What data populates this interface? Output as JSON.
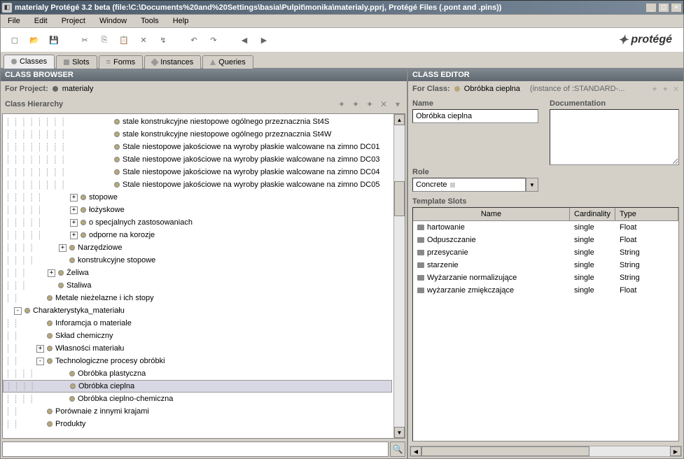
{
  "window": {
    "title": "materialy  Protégé 3.2 beta    (file:\\C:\\Documents%20and%20Settings\\basia\\Pulpit\\monika\\materialy.pprj, Protégé Files (.pont and .pins))"
  },
  "menu": [
    "File",
    "Edit",
    "Project",
    "Window",
    "Tools",
    "Help"
  ],
  "logo_text": "protégé",
  "tabs": [
    {
      "label": "Classes",
      "icon": "circle",
      "active": true
    },
    {
      "label": "Slots",
      "icon": "square",
      "active": false
    },
    {
      "label": "Forms",
      "icon": "lines",
      "active": false
    },
    {
      "label": "Instances",
      "icon": "diamond",
      "active": false
    },
    {
      "label": "Queries",
      "icon": "tri",
      "active": false
    }
  ],
  "browser": {
    "title": "CLASS BROWSER",
    "for_label": "For Project:",
    "project": "materialy",
    "hierarchy_label": "Class Hierarchy",
    "tree": [
      {
        "indent": 140,
        "expander": null,
        "label": "stale konstrukcyjne niestopowe ogólnego przeznacznia St4S"
      },
      {
        "indent": 140,
        "expander": null,
        "label": "stale konstrukcyjne niestopowe ogólnego przeznacznia St4W"
      },
      {
        "indent": 140,
        "expander": null,
        "label": "Stale niestopowe jakościowe na wyroby płaskie walcowane na zimno DC01"
      },
      {
        "indent": 140,
        "expander": null,
        "label": "Stale niestopowe jakościowe na wyroby płaskie walcowane na zimno DC03"
      },
      {
        "indent": 140,
        "expander": null,
        "label": "Stale niestopowe jakościowe na wyroby płaskie walcowane na zimno DC04"
      },
      {
        "indent": 140,
        "expander": null,
        "label": "Stale niestopowe jakościowe na wyroby płaskie walcowane na zimno DC05"
      },
      {
        "indent": 92,
        "expander": "+",
        "label": "stopowe"
      },
      {
        "indent": 92,
        "expander": "+",
        "label": "łożyskowe"
      },
      {
        "indent": 92,
        "expander": "+",
        "label": "o specjalnych zastosowaniach"
      },
      {
        "indent": 92,
        "expander": "+",
        "label": "odporne na korozje"
      },
      {
        "indent": 76,
        "expander": "+",
        "label": "Narzędziowe"
      },
      {
        "indent": 76,
        "expander": null,
        "label": "konstrukcyjne stopowe"
      },
      {
        "indent": 60,
        "expander": "+",
        "label": "Żeliwa"
      },
      {
        "indent": 60,
        "expander": null,
        "label": "Staliwa"
      },
      {
        "indent": 44,
        "expander": null,
        "label": "Metale nieżelazne i ich stopy"
      },
      {
        "indent": 12,
        "expander": "-",
        "label": "Charakterystyka_materiału"
      },
      {
        "indent": 44,
        "expander": null,
        "label": "Inforamcja o materiale"
      },
      {
        "indent": 44,
        "expander": null,
        "label": "Skład chemiczny"
      },
      {
        "indent": 44,
        "expander": "+",
        "label": "Własności materiału"
      },
      {
        "indent": 44,
        "expander": "-",
        "label": "Technologiczne procesy obróbki"
      },
      {
        "indent": 76,
        "expander": null,
        "label": "Obróbka plastyczna"
      },
      {
        "indent": 76,
        "expander": null,
        "label": "Obróbka cieplna",
        "selected": true
      },
      {
        "indent": 76,
        "expander": null,
        "label": "Obróbka cieplno-chemiczna"
      },
      {
        "indent": 44,
        "expander": null,
        "label": "Porównaie z innymi krajami"
      },
      {
        "indent": 44,
        "expander": null,
        "label": "Produkty"
      }
    ]
  },
  "editor": {
    "title": "CLASS EDITOR",
    "for_label": "For Class:",
    "class_name": "Obróbka cieplna",
    "instance_of": "(instance of :STANDARD-...",
    "name_label": "Name",
    "name_value": "Obróbka cieplna",
    "doc_label": "Documentation",
    "role_label": "Role",
    "role_value": "Concrete",
    "slots_label": "Template Slots",
    "columns": {
      "name": "Name",
      "card": "Cardinality",
      "type": "Type"
    },
    "slots": [
      {
        "name": "hartowanie",
        "card": "single",
        "type": "Float"
      },
      {
        "name": "Odpuszczanie",
        "card": "single",
        "type": "Float"
      },
      {
        "name": "przesycanie",
        "card": "single",
        "type": "String"
      },
      {
        "name": "starzenie",
        "card": "single",
        "type": "String"
      },
      {
        "name": "Wyżarzanie normalizujące",
        "card": "single",
        "type": "String"
      },
      {
        "name": "wyżarzanie zmiękczające",
        "card": "single",
        "type": "Float"
      }
    ]
  }
}
